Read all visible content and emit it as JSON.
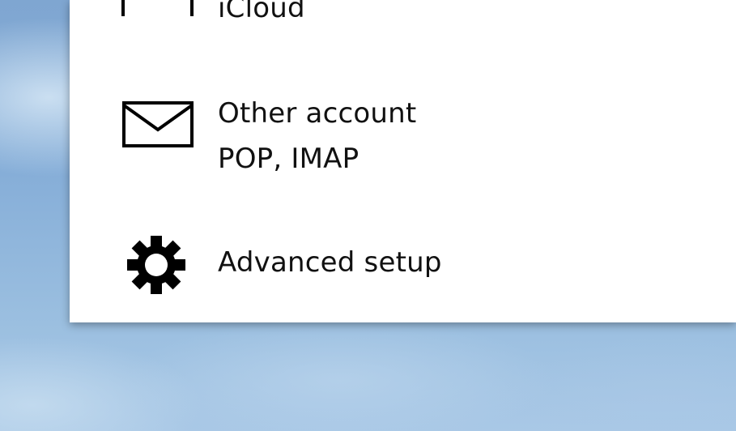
{
  "account_options": [
    {
      "label": "iCloud",
      "icon": "box-outline-icon"
    },
    {
      "label": "Other account",
      "subtitle": "POP, IMAP",
      "icon": "envelope-icon"
    },
    {
      "label": "Advanced setup",
      "icon": "gear-icon"
    }
  ],
  "colors": {
    "panel_background": "#ffffff",
    "text": "#111111",
    "desktop_sky": "#86aed8"
  }
}
